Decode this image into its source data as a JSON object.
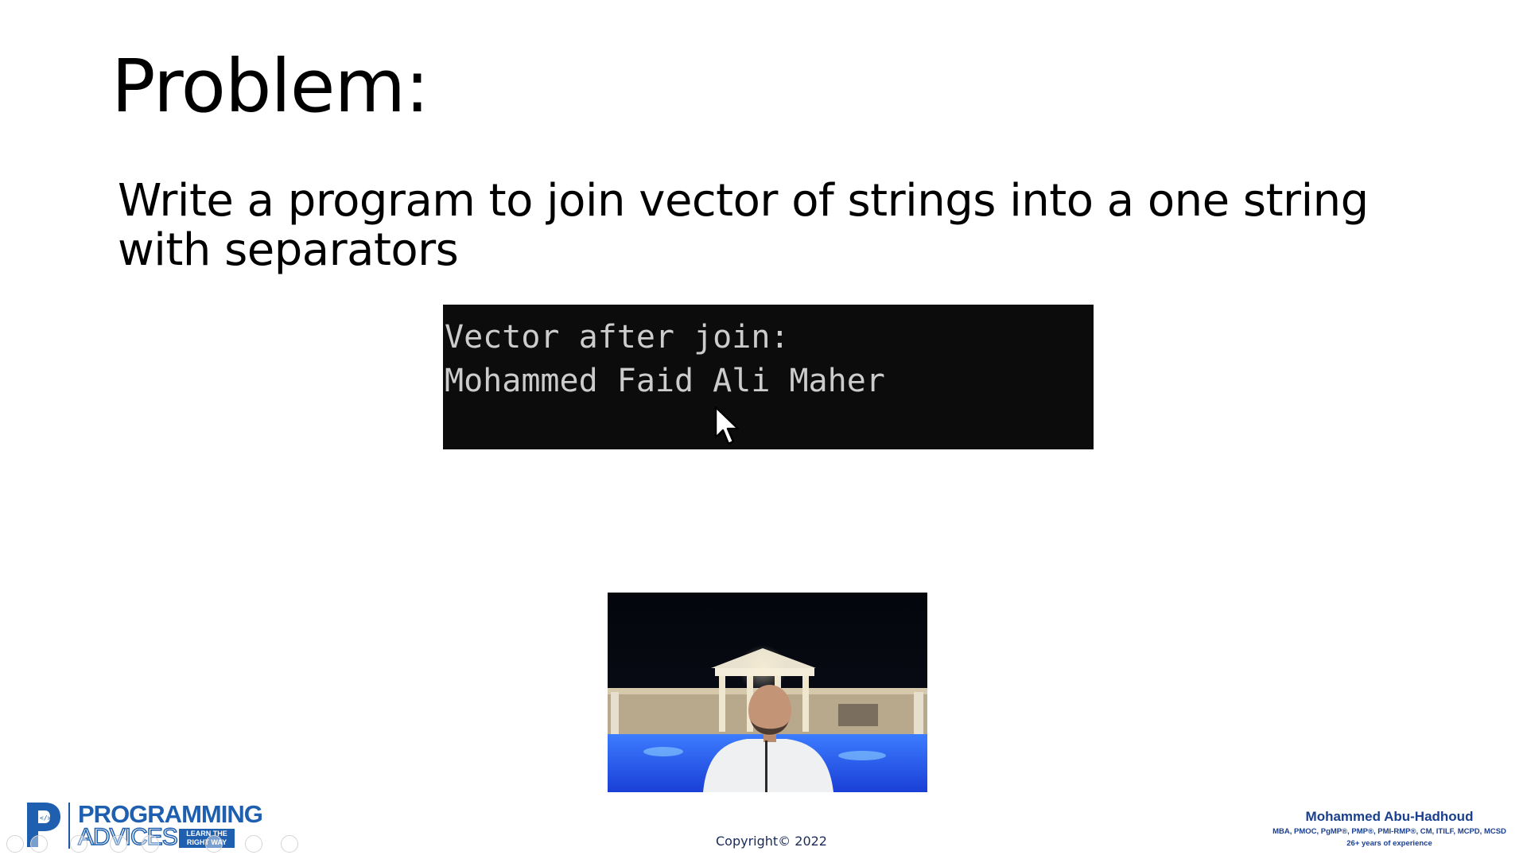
{
  "slide": {
    "title": "Problem:",
    "problem_line1": "Write a program to join vector of strings into a one string",
    "problem_line2": "with separators"
  },
  "console": {
    "lines": [
      "Vector after join:",
      "Mohammed Faid Ali Maher"
    ],
    "background": "#0c0c0c",
    "text_color": "#cccccc"
  },
  "footer": {
    "logo_top": "PROGRAMMING",
    "logo_bottom": "ADVICES",
    "logo_tag_line1": "LEARN THE",
    "logo_tag_line2": "RIGHT WAY",
    "copyright": "Copyright© 2022",
    "author_name": "Mohammed Abu-Hadhoud",
    "author_credentials": "MBA, PMOC, PgMP®, PMP®, PMI-RMP®, CM, ITILF, MCPD, MCSD",
    "author_experience": "26+ years of experience",
    "brand_color": "#1e5fb0"
  },
  "icons": {
    "cursor": "mouse-pointer-icon",
    "logo": "programming-advices-logo-icon",
    "nav": [
      "nav-prev-icon",
      "nav-next-icon",
      "pen-icon",
      "pointer-icon",
      "zoom-icon",
      "subtitles-icon",
      "eraser-icon",
      "more-icon"
    ]
  }
}
